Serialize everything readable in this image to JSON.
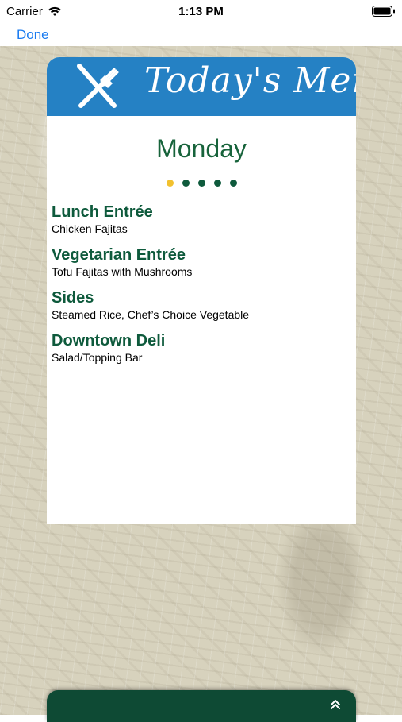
{
  "status_bar": {
    "carrier": "Carrier",
    "time": "1:13 PM"
  },
  "nav": {
    "done_label": "Done"
  },
  "header": {
    "title": "Today's Menu",
    "brand_color": "#2581c4"
  },
  "day": {
    "name": "Monday",
    "color": "#17633b"
  },
  "pager": {
    "count": 5,
    "active_index": 0,
    "active_color": "#f2c12e",
    "inactive_color": "#0e5a3c"
  },
  "sections": [
    {
      "title": "Lunch Entrée",
      "items": "Chicken Fajitas"
    },
    {
      "title": "Vegetarian Entrée",
      "items": "Tofu Fajitas with Mushrooms"
    },
    {
      "title": "Sides",
      "items": "Steamed Rice, Chef’s Choice Vegetable"
    },
    {
      "title": "Downtown Deli",
      "items": "Salad/Topping Bar"
    }
  ],
  "drawer": {
    "icon": "chevron-double-up-icon",
    "color": "#0e4a34"
  }
}
